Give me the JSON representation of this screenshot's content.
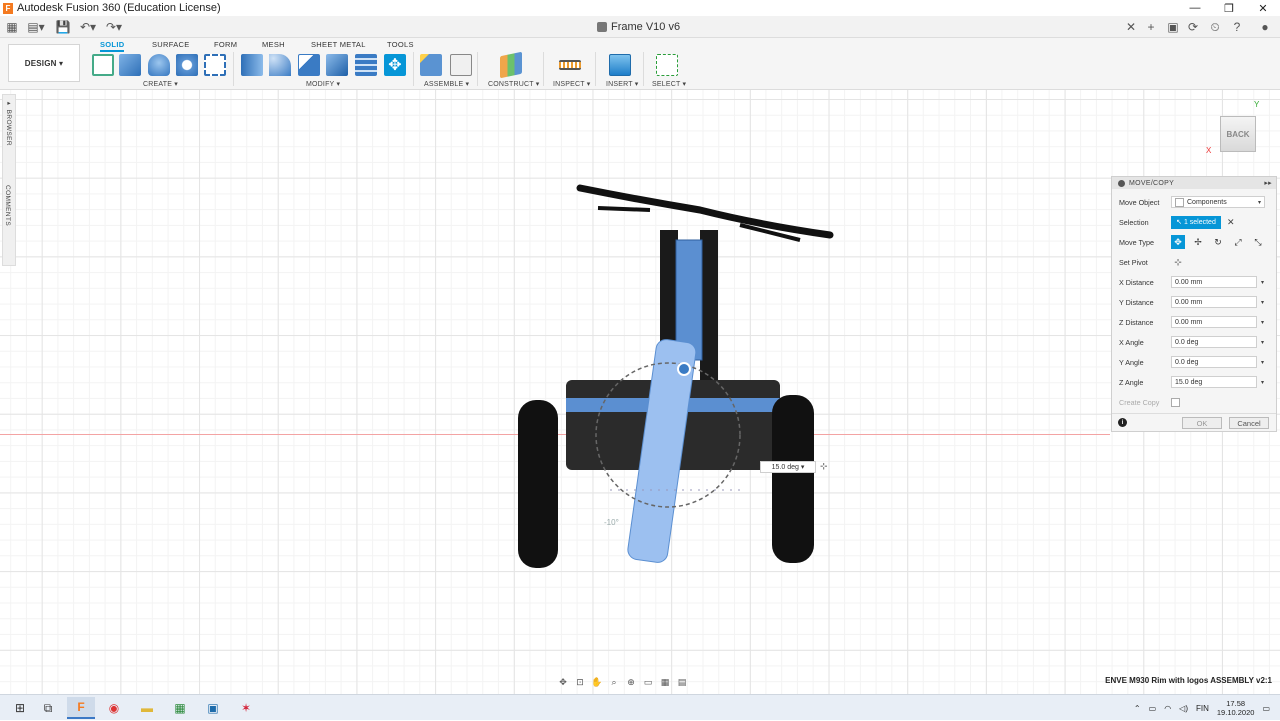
{
  "window": {
    "title": "Autodesk Fusion 360 (Education License)",
    "app_icon": "F"
  },
  "document": {
    "tab_title": "Frame V10 v6"
  },
  "ribbon": {
    "workspace": "DESIGN",
    "tabs": [
      "SOLID",
      "SURFACE",
      "FORM",
      "MESH",
      "SHEET METAL",
      "TOOLS"
    ],
    "active_tab": "SOLID",
    "groups": [
      "CREATE",
      "MODIFY",
      "ASSEMBLE",
      "CONSTRUCT",
      "INSPECT",
      "INSERT",
      "SELECT"
    ]
  },
  "side_tabs": {
    "browser": "BROWSER",
    "comments": "COMMENTS"
  },
  "viewcube": {
    "face": "BACK",
    "x": "X",
    "y": "Y"
  },
  "move_copy": {
    "title": "MOVE/COPY",
    "move_object_label": "Move Object",
    "move_object_value": "Components",
    "selection_label": "Selection",
    "selection_value": "1 selected",
    "move_type_label": "Move Type",
    "set_pivot_label": "Set Pivot",
    "x_distance_label": "X Distance",
    "x_distance_value": "0.00 mm",
    "y_distance_label": "Y Distance",
    "y_distance_value": "0.00 mm",
    "z_distance_label": "Z Distance",
    "z_distance_value": "0.00 mm",
    "x_angle_label": "X Angle",
    "x_angle_value": "0.0 deg",
    "y_angle_label": "Y Angle",
    "y_angle_value": "0.0 deg",
    "z_angle_label": "Z Angle",
    "z_angle_value": "15.0 deg",
    "create_copy_label": "Create Copy",
    "ok_label": "OK",
    "cancel_label": "Cancel"
  },
  "canvas": {
    "angle_input": "15.0 deg",
    "tick_label": "-10°"
  },
  "status": {
    "text": "ENVE M930 Rim with logos ASSEMBLY v2:1"
  },
  "taskbar": {
    "language": "FIN",
    "time": "17.58",
    "date": "19.10.2020"
  },
  "colors": {
    "accent": "#0696d7",
    "model_blue": "#5b8fd1",
    "origin_red": "#f3a3a3"
  }
}
